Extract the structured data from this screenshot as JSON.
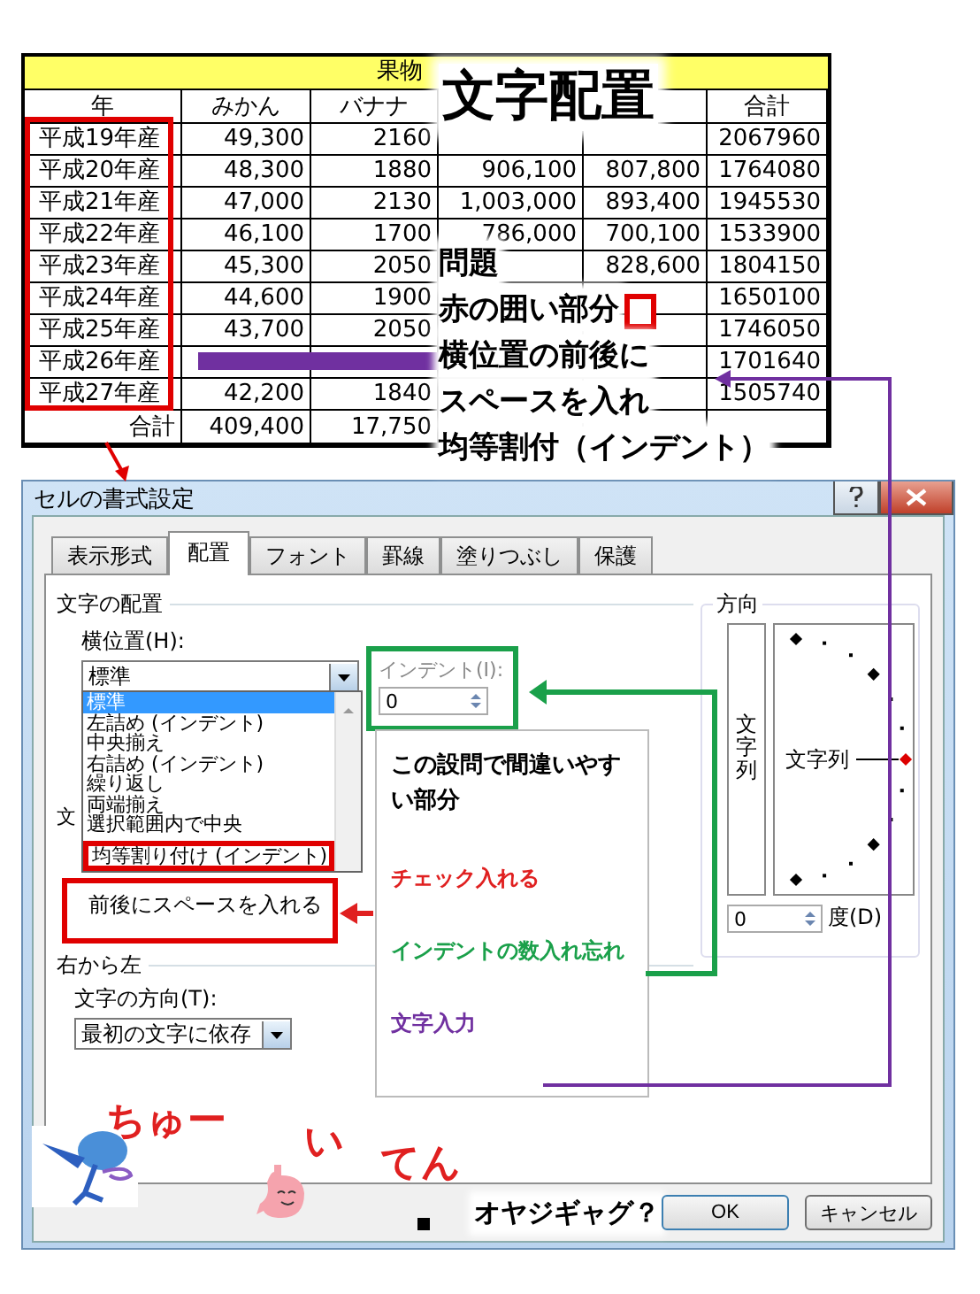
{
  "table": {
    "title": "果物",
    "columns": [
      "年",
      "みかん",
      "バナナ",
      "",
      "",
      "合計"
    ],
    "rows": [
      {
        "cells": [
          "平成19年産",
          "49,300",
          "2160",
          "",
          "",
          "2067960"
        ]
      },
      {
        "cells": [
          "平成20年産",
          "48,300",
          "1880",
          "906,100",
          "807,800",
          "1764080"
        ]
      },
      {
        "cells": [
          "平成21年産",
          "47,000",
          "2130",
          "1,003,000",
          "893,400",
          "1945530"
        ]
      },
      {
        "cells": [
          "平成22年産",
          "46,100",
          "1700",
          "786,000",
          "700,100",
          "1533900"
        ]
      },
      {
        "cells": [
          "平成23年産",
          "45,300",
          "2050",
          "",
          "828,600",
          "1804150"
        ]
      },
      {
        "cells": [
          "平成24年産",
          "44,600",
          "1900",
          "",
          "",
          "1650100"
        ]
      },
      {
        "cells": [
          "平成25年産",
          "43,700",
          "2050",
          "",
          "",
          "1746050"
        ]
      },
      {
        "cells": [
          "平成26年産",
          "",
          "",
          "",
          "",
          "1701640"
        ]
      },
      {
        "cells": [
          "平成27年産",
          "42,200",
          "1840",
          "",
          "",
          "1505740"
        ]
      },
      {
        "cells": [
          "合計",
          "409,400",
          "17,750",
          "",
          "",
          ""
        ]
      }
    ]
  },
  "annotation": {
    "heading": "文字配置",
    "lines": [
      "問題",
      "赤の囲い部分",
      "横位置の前後に",
      "スペースを入れ",
      "均等割付（インデント）"
    ]
  },
  "dialog": {
    "title": "セルの書式設定",
    "tabs": [
      {
        "label": "表示形式",
        "selected": false
      },
      {
        "label": "配置",
        "selected": true
      },
      {
        "label": "フォント",
        "selected": false
      },
      {
        "label": "罫線",
        "selected": false
      },
      {
        "label": "塗りつぶし",
        "selected": false
      },
      {
        "label": "保護",
        "selected": false
      }
    ],
    "alignment_group": "文字の配置",
    "horizontal_label": "横位置(H):",
    "horizontal_value": "標準",
    "dropdown": [
      {
        "label": "標準",
        "selected": true,
        "marked": false
      },
      {
        "label": "左詰め (インデント)",
        "selected": false,
        "marked": false
      },
      {
        "label": "中央揃え",
        "selected": false,
        "marked": false
      },
      {
        "label": "右詰め (インデント)",
        "selected": false,
        "marked": false
      },
      {
        "label": "繰り返し",
        "selected": false,
        "marked": false
      },
      {
        "label": "両端揃え",
        "selected": false,
        "marked": false
      },
      {
        "label": "選択範囲内で中央",
        "selected": false,
        "marked": false
      },
      {
        "label": "均等割り付け (インデント)",
        "selected": false,
        "marked": true
      }
    ],
    "indent_label": "インデント(I):",
    "indent_value": "0",
    "control_group_partial": "文",
    "checkbox_label": "前後にスペースを入れる",
    "rtl_group": "右から左",
    "direction_label": "文字の方向(T):",
    "direction_value": "最初の文字に依存",
    "orientation": {
      "title": "方向",
      "vertical_text": "文字列",
      "dial_text": "文字列",
      "degrees": "0",
      "degrees_label": "度(D)"
    },
    "joke": "オヤジギャグ？",
    "buttons": [
      "OK",
      "キャンセル"
    ]
  },
  "note": {
    "heading": "この設問で間違いやすい部分",
    "items": [
      {
        "text": "チェック入れる",
        "color": "#e02020"
      },
      {
        "text": "インデントの数入れ忘れ",
        "color": "#1aa04a"
      },
      {
        "text": "文字入力",
        "color": "#7030a0"
      }
    ]
  },
  "doodles": [
    "ちゅー",
    "い",
    "てん"
  ]
}
